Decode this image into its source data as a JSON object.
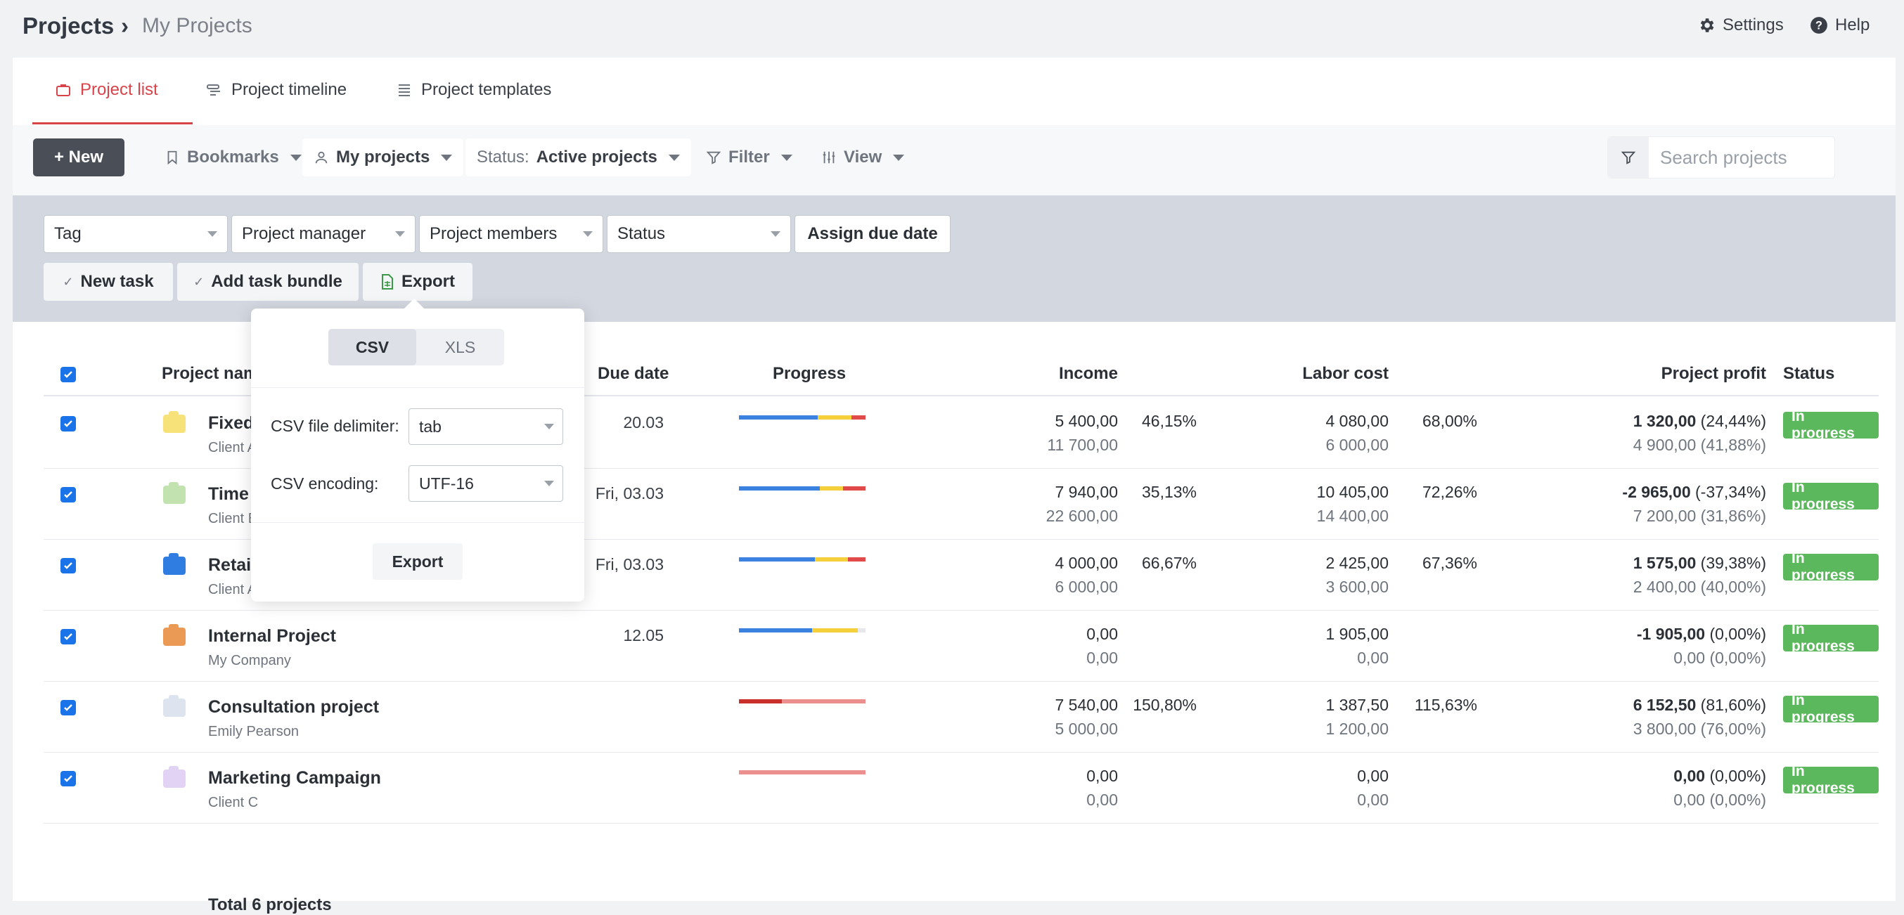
{
  "breadcrumb": {
    "root": "Projects",
    "separator": "›",
    "current": "My Projects"
  },
  "top_links": {
    "settings": "Settings",
    "help": "Help"
  },
  "tabs": [
    {
      "label": "Project list",
      "active": true,
      "icon": "briefcase-icon"
    },
    {
      "label": "Project timeline",
      "active": false,
      "icon": "timeline-icon"
    },
    {
      "label": "Project templates",
      "active": false,
      "icon": "list-icon"
    }
  ],
  "toolbar": {
    "new_label": "+ New",
    "bookmarks": "Bookmarks",
    "my_projects": "My projects",
    "status_prefix": "Status:",
    "status_value": "Active projects",
    "filter": "Filter",
    "view": "View",
    "search_placeholder": "Search projects"
  },
  "filters": {
    "tag": "Tag",
    "project_manager": "Project manager",
    "project_members": "Project members",
    "status": "Status",
    "assign_due_date": "Assign due date"
  },
  "actions": {
    "new_task": "New task",
    "add_task_bundle": "Add task bundle",
    "export": "Export"
  },
  "export_popover": {
    "formats": [
      "CSV",
      "XLS"
    ],
    "selected_format": "CSV",
    "delimiter_label": "CSV file delimiter:",
    "delimiter_value": "tab",
    "encoding_label": "CSV encoding:",
    "encoding_value": "UTF-16",
    "export_button": "Export"
  },
  "table": {
    "headers": {
      "name": "Project name",
      "due": "Due date",
      "progress": "Progress",
      "income": "Income",
      "labor": "Labor cost",
      "profit": "Project profit",
      "status": "Status"
    },
    "rows": [
      {
        "name": "Fixed P",
        "client": "Client A",
        "folder_color": "#f7e27a",
        "due": "20.03",
        "progress": [
          0.62,
          0.27,
          0.11
        ],
        "income": "5 400,00",
        "income_sub": "11 700,00",
        "income_pct": "46,15%",
        "labor": "4 080,00",
        "labor_sub": "6 000,00",
        "labor_pct": "68,00%",
        "profit": "1 320,00",
        "profit_pct": "(24,44%)",
        "profit_sub": "4 900,00 (41,88%)",
        "status": "In progress"
      },
      {
        "name": "Time a",
        "client": "Client B",
        "folder_color": "#c2e3b0",
        "due": "Fri, 03.03",
        "progress": [
          0.64,
          0.18,
          0.18
        ],
        "income": "7 940,00",
        "income_sub": "22 600,00",
        "income_pct": "35,13%",
        "labor": "10 405,00",
        "labor_sub": "14 400,00",
        "labor_pct": "72,26%",
        "profit": "-2 965,00",
        "profit_pct": "(-37,34%)",
        "profit_sub": "7 200,00 (31,86%)",
        "status": "In progress"
      },
      {
        "name": "Retaine",
        "client": "Client A",
        "folder_color": "#2f7de1",
        "due": "Fri, 03.03",
        "progress": [
          0.6,
          0.26,
          0.14
        ],
        "income": "4 000,00",
        "income_sub": "6 000,00",
        "income_pct": "66,67%",
        "labor": "2 425,00",
        "labor_sub": "3 600,00",
        "labor_pct": "67,36%",
        "profit": "1 575,00",
        "profit_pct": "(39,38%)",
        "profit_sub": "2 400,00 (40,00%)",
        "status": "In progress"
      },
      {
        "name": "Internal Project",
        "client": "My Company",
        "folder_color": "#eb9a55",
        "due": "12.05",
        "progress": [
          0.58,
          0.36,
          0.06
        ],
        "income": "0,00",
        "income_sub": "0,00",
        "income_pct": "",
        "labor": "1 905,00",
        "labor_sub": "0,00",
        "labor_pct": "",
        "profit": "-1 905,00",
        "profit_pct": "(0,00%)",
        "profit_sub": "0,00 (0,00%)",
        "status": "In progress"
      },
      {
        "name": "Consultation project",
        "client": "Emily Pearson",
        "folder_color": "#dde4f0",
        "due": "",
        "progress": [
          0.34,
          0.66,
          0
        ],
        "income": "7 540,00",
        "income_sub": "5 000,00",
        "income_pct": "150,80%",
        "labor": "1 387,50",
        "labor_sub": "1 200,00",
        "labor_pct": "115,63%",
        "profit": "6 152,50",
        "profit_pct": "(81,60%)",
        "profit_sub": "3 800,00 (76,00%)",
        "status": "In progress"
      },
      {
        "name": "Marketing Campaign",
        "client": "Client C",
        "folder_color": "#e2d3f5",
        "due": "",
        "progress": [
          0,
          1,
          0
        ],
        "income": "0,00",
        "income_sub": "0,00",
        "income_pct": "",
        "labor": "0,00",
        "labor_sub": "0,00",
        "labor_pct": "",
        "profit": "0,00",
        "profit_pct": "(0,00%)",
        "profit_sub": "0,00 (0,00%)",
        "status": "In progress"
      }
    ],
    "total": "Total 6 projects"
  },
  "colors": {
    "accent": "#d9434a",
    "checkbox": "#1a73e8",
    "status_green": "#5cb85c",
    "bar_blue": "#3b82e0",
    "bar_yellow": "#f5d03b",
    "bar_red": "#e04a4a",
    "bar_darkred": "#c9302c",
    "bar_pink": "#ec8f8f",
    "bar_gray": "#e6e8eb"
  }
}
